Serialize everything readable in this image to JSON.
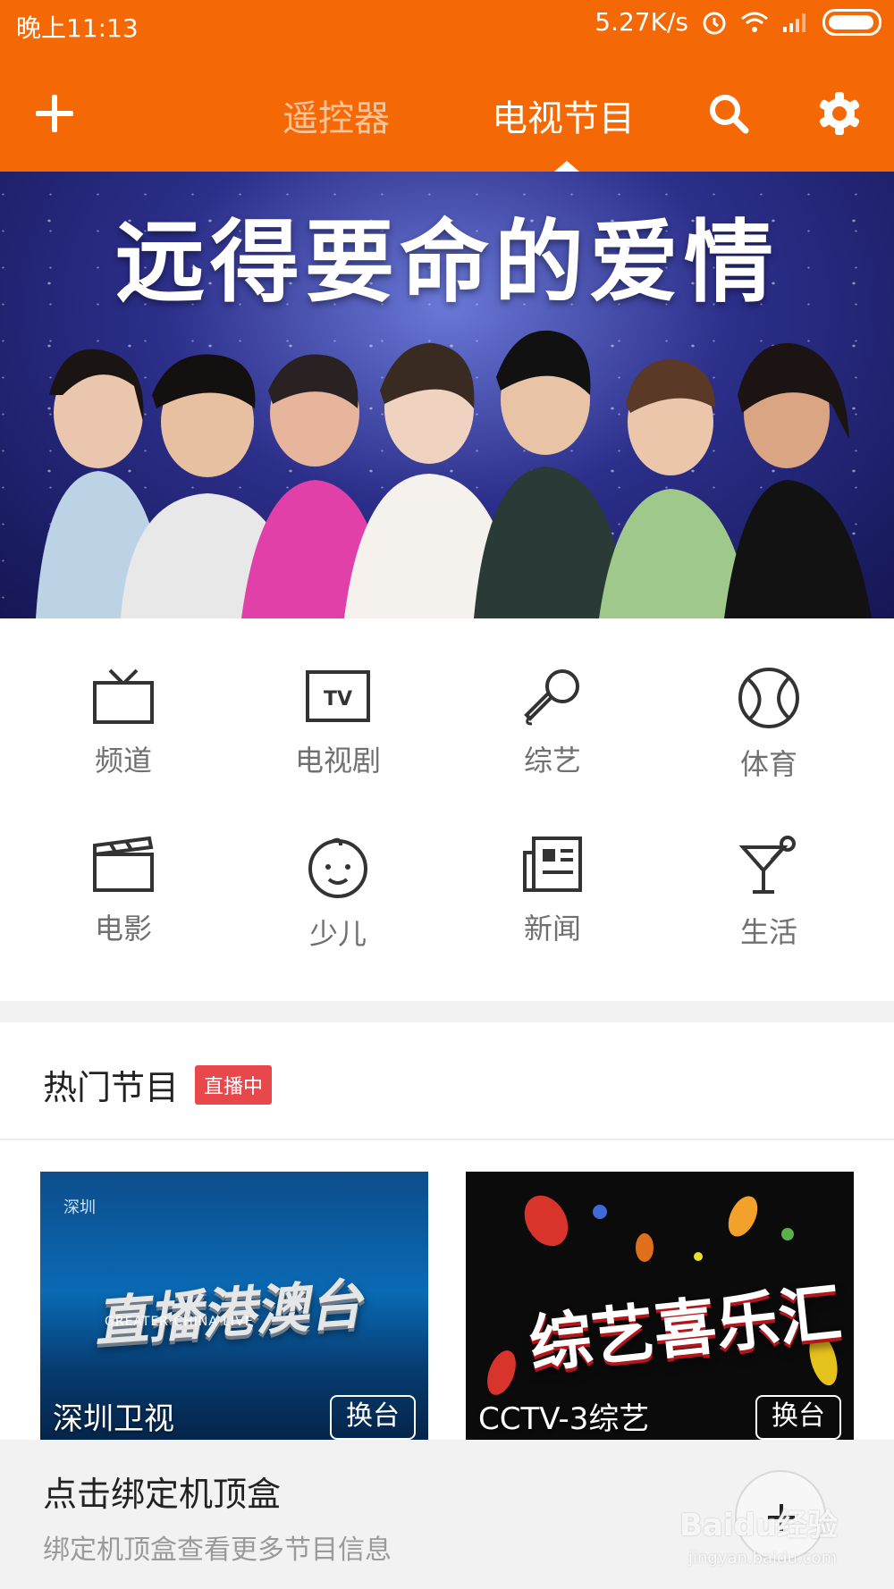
{
  "status_bar": {
    "time": "晚上11:13",
    "speed": "5.27K/s"
  },
  "header": {
    "tabs": [
      {
        "label": "遥控器"
      },
      {
        "label": "电视节目"
      }
    ],
    "accent_color": "#f46906"
  },
  "banner": {
    "title": "远得要命的爱情"
  },
  "categories": [
    {
      "label": "频道",
      "icon": "tv-channel-icon"
    },
    {
      "label": "电视剧",
      "icon": "tv-icon"
    },
    {
      "label": "综艺",
      "icon": "microphone-icon"
    },
    {
      "label": "体育",
      "icon": "ball-icon"
    },
    {
      "label": "电影",
      "icon": "clapperboard-icon"
    },
    {
      "label": "少儿",
      "icon": "baby-face-icon"
    },
    {
      "label": "新闻",
      "icon": "newspaper-icon"
    },
    {
      "label": "生活",
      "icon": "cocktail-icon"
    }
  ],
  "hot_section": {
    "title": "热门节目",
    "badge": "直播中",
    "cards": [
      {
        "channel": "深圳卫视",
        "button": "换台",
        "logo_text": "直播港澳台",
        "logo_sub": "GREATER CHINA LIVE",
        "watermark": "深圳"
      },
      {
        "channel": "CCTV-3综艺",
        "button": "换台",
        "logo_text": "综艺喜乐汇"
      }
    ]
  },
  "bind_sheet": {
    "title": "点击绑定机顶盒",
    "subtitle": "绑定机顶盒查看更多节目信息"
  },
  "watermark": {
    "brand": "Baidu经验",
    "url": "jingyan.baidu.com"
  }
}
